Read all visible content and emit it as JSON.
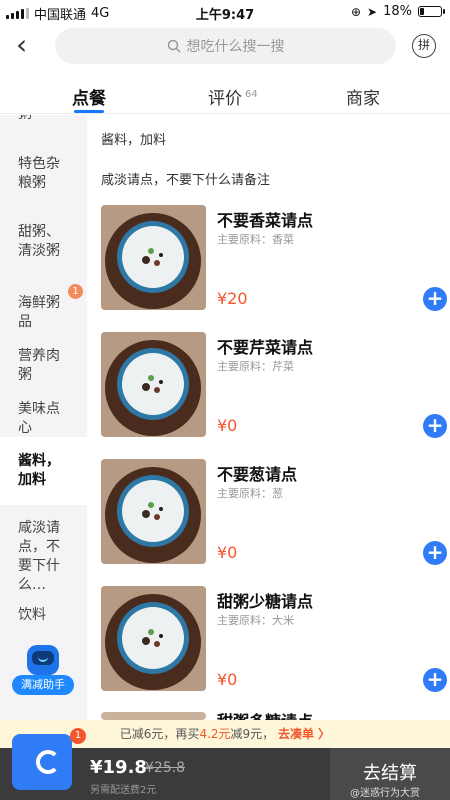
{
  "status": {
    "carrier": "中国联通",
    "network": "4G",
    "time": "上午9:47",
    "battery": "18%"
  },
  "header": {
    "search_placeholder": "想吃什么搜一搜",
    "pin_label": "拼"
  },
  "tabs": {
    "order": "点餐",
    "reviews": "评价",
    "reviews_count": "64",
    "merchant": "商家"
  },
  "sidebar": {
    "partial_top": "粥",
    "items": [
      {
        "label": "特色杂粮粥"
      },
      {
        "label": "甜粥、清淡粥"
      },
      {
        "label": "海鲜粥品",
        "badge": "1"
      },
      {
        "label": "营养肉粥"
      },
      {
        "label": "美味点心"
      },
      {
        "label": "酱料，加料"
      },
      {
        "label": "咸淡请点，不要下什么…"
      },
      {
        "label": "饮料"
      }
    ],
    "helper_label": "满减助手"
  },
  "main": {
    "section_title": "酱料，加料",
    "section_subtitle": "咸淡请点，不要下什么请备注",
    "items": [
      {
        "name": "不要香菜请点",
        "ingredients": "主要原料：香菜",
        "price": "¥20"
      },
      {
        "name": "不要芹菜请点",
        "ingredients": "主要原料：芹菜",
        "price": "¥0"
      },
      {
        "name": "不要葱请点",
        "ingredients": "主要原料：葱",
        "price": "¥0"
      },
      {
        "name": "甜粥少糖请点",
        "ingredients": "主要原料：大米",
        "price": "¥0"
      }
    ],
    "partial_next": "甜粥多糖请点"
  },
  "promo": {
    "part1": "已减6元，再买",
    "amount": "4.2元",
    "part2": "减9元，",
    "action": "去凑单 〉"
  },
  "cart": {
    "badge": "1",
    "price_now": "¥19.8",
    "price_orig": "¥25.8",
    "delivery": "另需配送费2元",
    "checkout": "去结算",
    "watermark": "@迷惑行为大赏"
  }
}
